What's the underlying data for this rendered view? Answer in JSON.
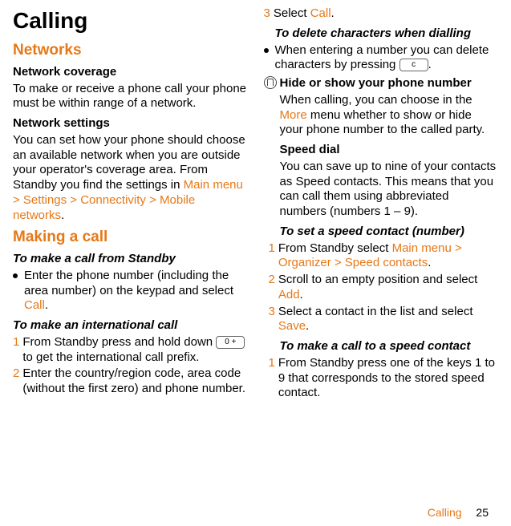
{
  "col1": {
    "title": "Calling",
    "h2_networks": "Networks",
    "h3_coverage": "Network coverage",
    "p_coverage": "To make or receive a phone call your phone must be within range of a network.",
    "h3_settings": "Network settings",
    "p_settings_a": "You can set how your phone should choose an available network when you are outside your operator's coverage area. From Standby you find the settings in ",
    "p_settings_path": "Main menu > Settings > Connectivity > Mobile networks",
    "p_settings_b": ".",
    "h2_making": "Making a call",
    "h4_standby": "To make a call from Standby",
    "b1_a": "Enter the phone number (including the area number) on the keypad and select ",
    "b1_call": "Call",
    "b1_b": ".",
    "h4_intl": "To make an international call",
    "n1_a": "From Standby press and hold down ",
    "key1": "0 +",
    "n1_b": " to get the international call prefix.",
    "n2": "Enter the country/region code, area code (without the first zero) and phone number."
  },
  "col2": {
    "n3_a": "Select ",
    "n3_call": "Call",
    "n3_b": ".",
    "h4_delete": "To delete characters when dialling",
    "b2_a": "When entering a number you can delete characters by pressing ",
    "key2": "c",
    "b2_b": ".",
    "h3_hide": "Hide or show your phone number",
    "p_hide_a": "When calling, you can choose in the ",
    "p_hide_more": "More",
    "p_hide_b": " menu whether to show or hide your phone number to the called party.",
    "h3_speed": "Speed dial",
    "p_speed": "You can save up to nine of your contacts as Speed contacts. This means that you can call them using abbreviated numbers (numbers 1 – 9).",
    "h4_set_speed": "To set a speed contact (number)",
    "s1_a": "From Standby select ",
    "s1_path": "Main menu > Organizer > Speed contacts",
    "s1_b": ".",
    "s2_a": "Scroll to an empty position and select ",
    "s2_add": "Add",
    "s2_b": ".",
    "s3_a": "Select a contact in the list and select ",
    "s3_save": "Save",
    "s3_b": ".",
    "h4_call_speed": "To make a call to a speed contact",
    "c1": "From Standby press one of the keys 1 to 9 that corresponds to the stored speed contact."
  },
  "footer": {
    "section": "Calling",
    "page": "25"
  }
}
